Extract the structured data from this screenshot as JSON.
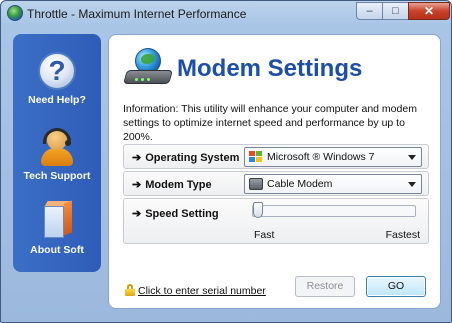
{
  "window": {
    "title": "Throttle - Maximum Internet Performance",
    "buttons": {
      "minimize": "–",
      "maximize": "□",
      "close": "✕"
    }
  },
  "sidebar": {
    "items": [
      {
        "label": "Need Help?",
        "icon": "help-icon"
      },
      {
        "label": "Tech Support",
        "icon": "tech-support-icon"
      },
      {
        "label": "About Soft",
        "icon": "software-box-icon"
      }
    ]
  },
  "main": {
    "title": "Modem Settings",
    "header_icon": "globe-modem-icon",
    "info": "Information: This utility will enhance your computer and modem settings to optimize internet speed and performance by up to 200%.",
    "settings": {
      "operating_system": {
        "label": "Operating System",
        "value": "Microsoft ® Windows 7",
        "icon": "windows-logo-icon"
      },
      "modem_type": {
        "label": "Modem Type",
        "value": "Cable Modem",
        "icon": "cable-modem-icon"
      },
      "speed": {
        "label": "Speed Setting",
        "min_label": "Fast",
        "max_label": "Fastest",
        "level": 0
      }
    },
    "serial_link": "Click to enter serial number",
    "buttons": {
      "restore": "Restore",
      "go": "GO"
    }
  },
  "colors": {
    "title_blue": "#1e4fa8",
    "sidebar_blue": "#2e5cb8",
    "close_red": "#c7432c"
  }
}
